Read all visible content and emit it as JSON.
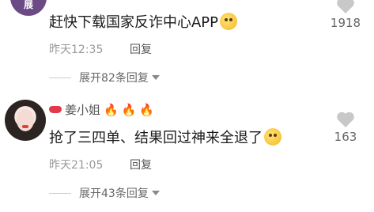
{
  "comment1": {
    "avatar_text": "展",
    "text": "赶快下载国家反诈中心APP",
    "emoji": "pleading-face-emoji",
    "time": "昨天12:35",
    "reply_label": "回复",
    "expand_label": "展开82条回复",
    "likes": "1918"
  },
  "comment2": {
    "username": "姜小姐",
    "badges": [
      "lips-icon",
      "fire-icon",
      "fire-icon",
      "fire-icon"
    ],
    "text": "抢了三四单、结果回过神来全退了",
    "emoji": "laughing-tears-emoji",
    "time": "昨天21:05",
    "reply_label": "回复",
    "expand_label": "展开43条回复",
    "likes": "163"
  },
  "colors": {
    "text": "#1a1a1a",
    "meta": "#9a9a9a",
    "heart": "#c8c8c8",
    "fire": "#f2841c"
  }
}
